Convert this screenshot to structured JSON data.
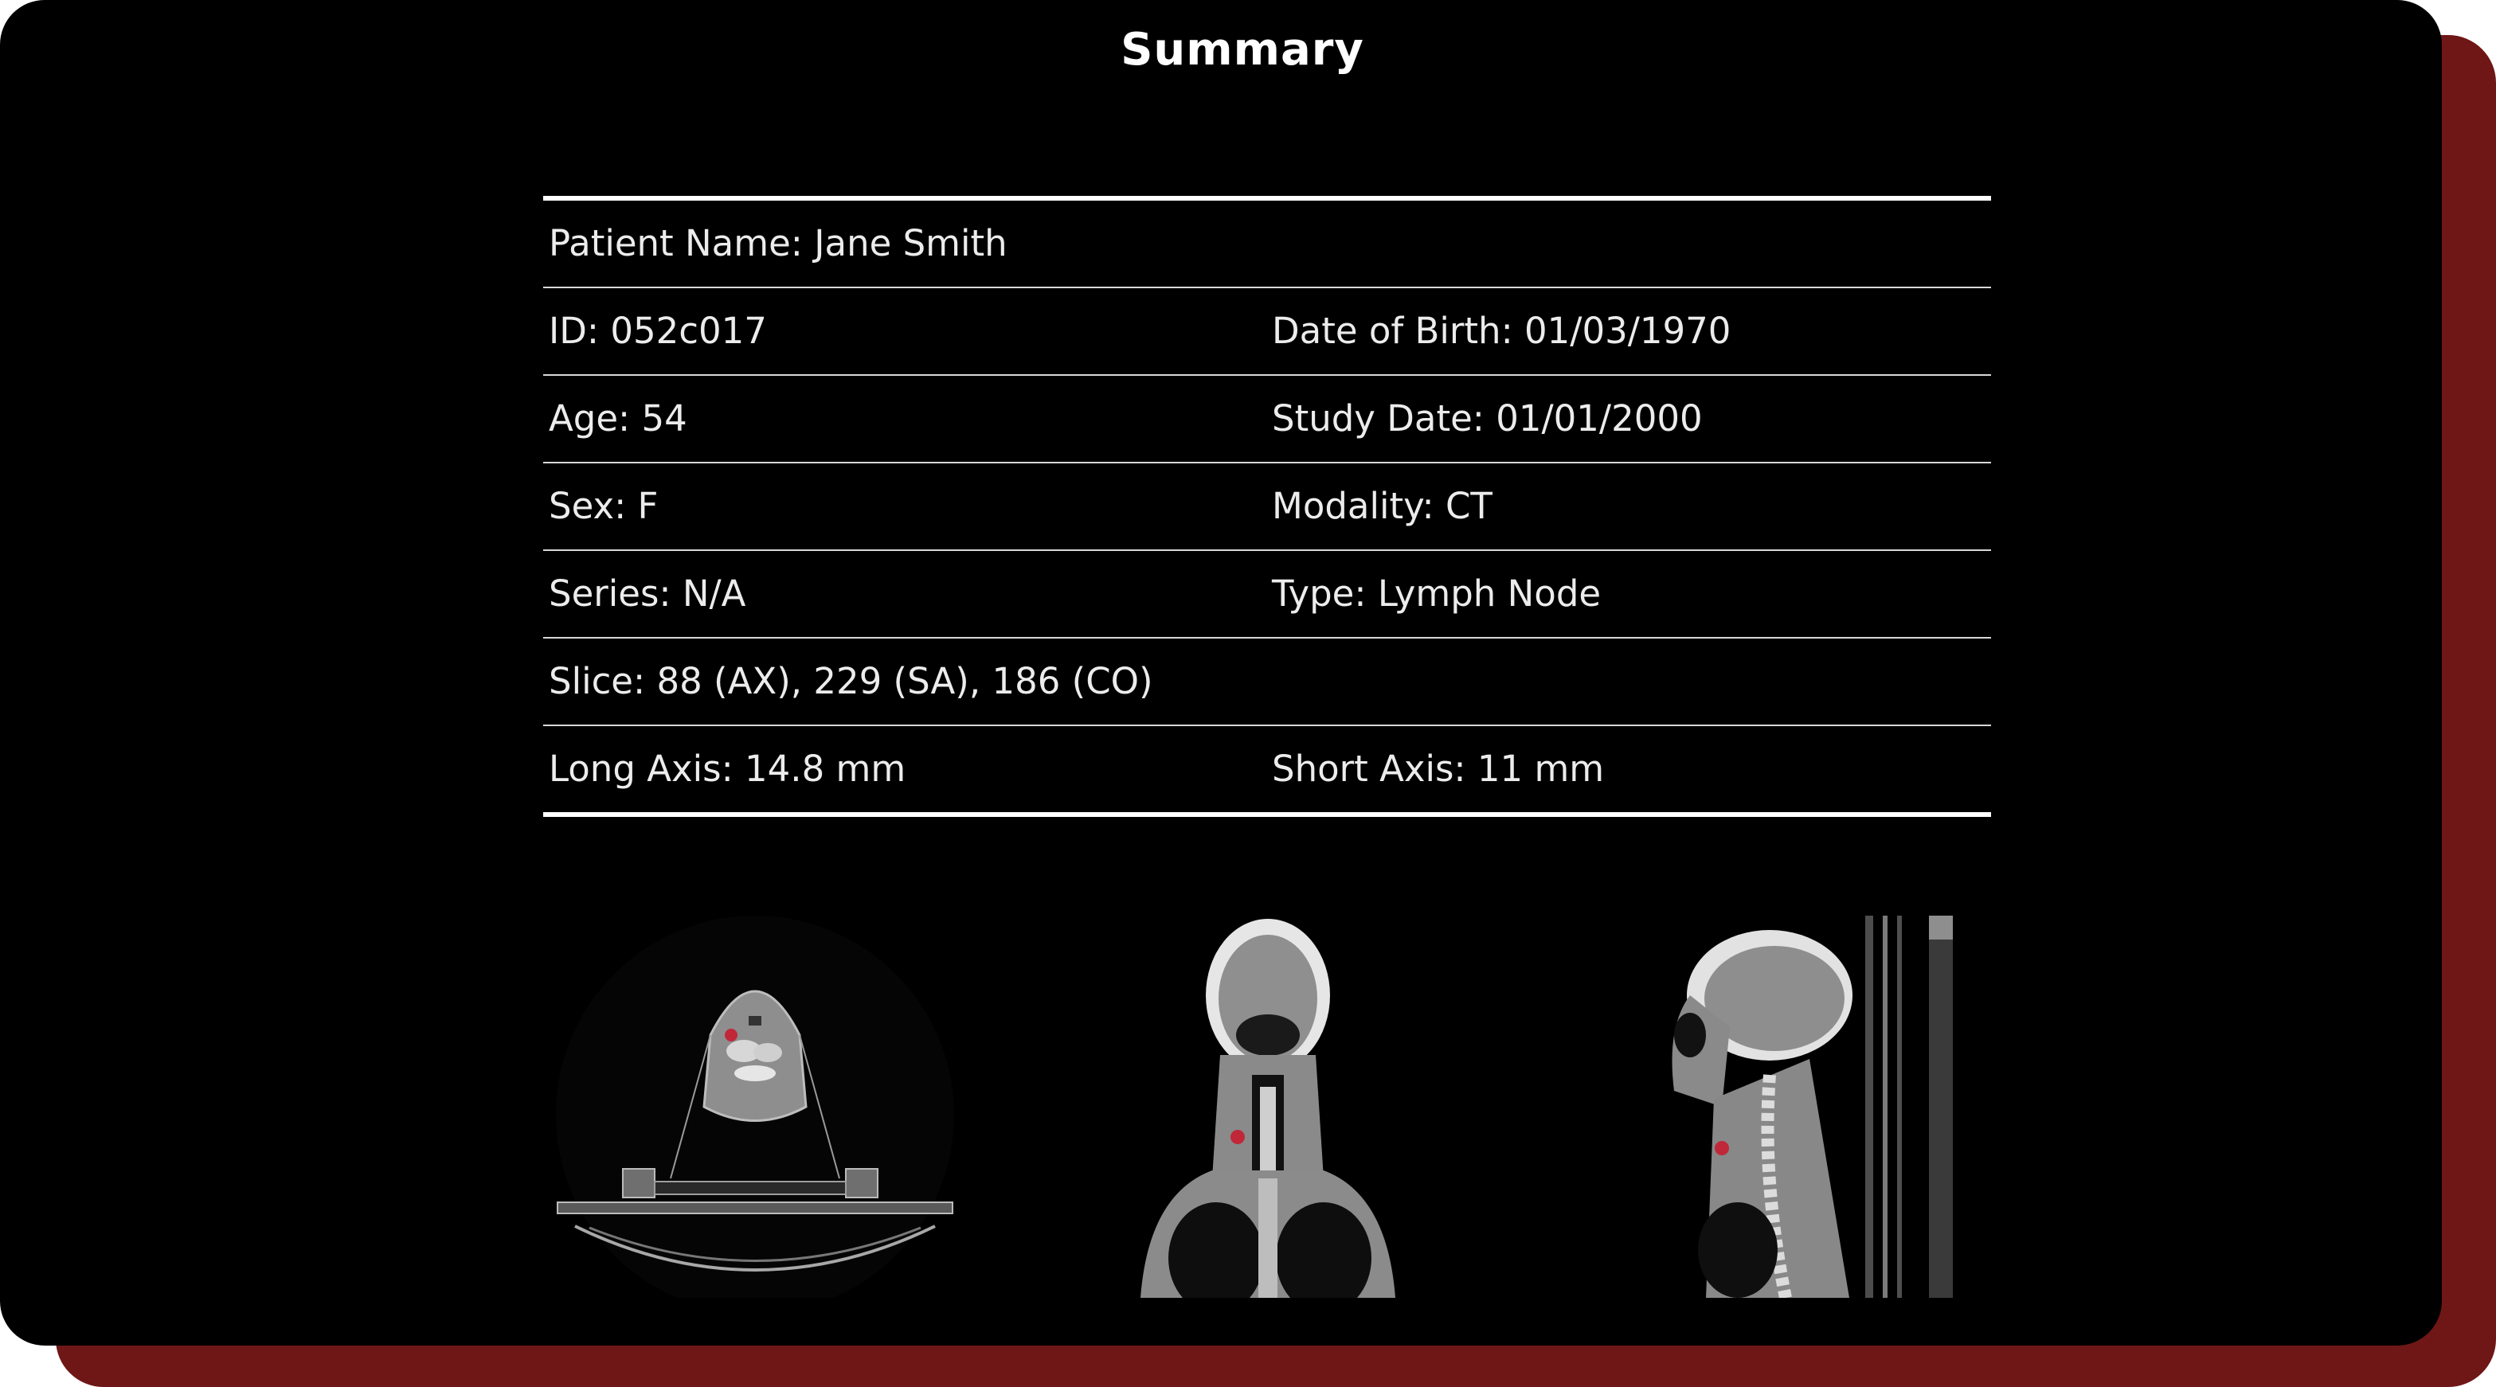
{
  "title": "Summary",
  "rows": [
    {
      "left": "Patient Name: Jane Smith",
      "right": ""
    },
    {
      "left": "ID: 052c017",
      "right": "Date of Birth: 01/03/1970"
    },
    {
      "left": "Age: 54",
      "right": "Study Date: 01/01/2000"
    },
    {
      "left": "Sex: F",
      "right": "Modality: CT"
    },
    {
      "left": "Series: N/A",
      "right": "Type: Lymph Node"
    },
    {
      "left": "Slice: 88 (AX), 229 (SA), 186 (CO)",
      "right": ""
    },
    {
      "left": "Long Axis: 14.8 mm",
      "right": "Short Axis: 11 mm"
    }
  ],
  "images": [
    {
      "name": "axial-ct-image"
    },
    {
      "name": "coronal-ct-image"
    },
    {
      "name": "sagittal-ct-image"
    }
  ],
  "colors": {
    "background": "#000000",
    "accent_shadow": "#6f1716",
    "lesion_marker": "#c0283a"
  }
}
